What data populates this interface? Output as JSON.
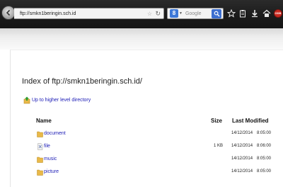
{
  "browser": {
    "url": "ftp://smkn1beringin.sch.id",
    "search_placeholder": "Google",
    "search_engine_badge": "8",
    "addon_label": "ODB"
  },
  "listing": {
    "title": "Index of ftp://smkn1beringin.sch.id/",
    "up_link": "Up to higher level directory",
    "columns": {
      "name": "Name",
      "size": "Size",
      "modified": "Last Modified"
    },
    "rows": [
      {
        "name": "document",
        "type": "folder",
        "size": "",
        "date": "14/12/2014",
        "time": "8:05:00"
      },
      {
        "name": "file",
        "type": "file",
        "size": "1 KB",
        "date": "14/12/2014",
        "time": "8:06:00"
      },
      {
        "name": "music",
        "type": "folder",
        "size": "",
        "date": "14/12/2014",
        "time": "8:05:00"
      },
      {
        "name": "picture",
        "type": "folder",
        "size": "",
        "date": "14/12/2014",
        "time": "8:05:00"
      }
    ]
  },
  "colors": {
    "link": "#1a1ab5",
    "folder": "#e9b949",
    "toolbar": "#1e1e1e"
  }
}
